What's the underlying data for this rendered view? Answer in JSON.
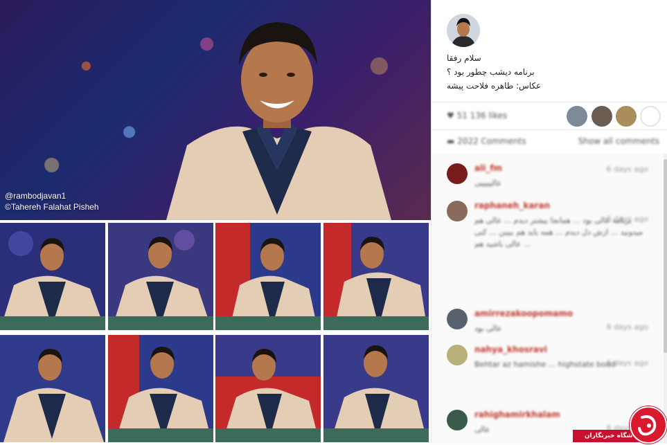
{
  "hero": {
    "handle": "@rambodjavan1",
    "photographer": "©Tahereh Falahat Pisheh"
  },
  "post": {
    "caption_lines": [
      "سلام رفقا",
      "برنامه دیشب چطور بود ؟",
      "عکاس: طاهره فلاحت پیشه"
    ],
    "likes_text": "51 136 likes",
    "comments_count_text": "2022 Comments",
    "show_all_label": "Show all comments"
  },
  "comments": [
    {
      "user": "ali_fm",
      "time": "6 days ago",
      "text": "عالیییییی"
    },
    {
      "user": "raphaneh_karan",
      "time": "6 days ago",
      "text": "برنامه عالی بود ... همانجا بیشتر دیدم ... عالی هم میدونید ... ازش دل دیدم ... همه باید هم ببینن ... کنی ... عالی باشید هم"
    },
    {
      "user": "amirrezakoopomamo",
      "time": "6 days ago",
      "text": "عالی بود"
    },
    {
      "user": "nahya_khosravi",
      "time": "6 days ago",
      "text": "Behtar az hamishe ... highstate bood"
    },
    {
      "user": "rahighamirkhalam",
      "time": "6 days ago",
      "text": "عالی"
    }
  ],
  "watermark": {
    "label": "باشگاه خبرنگاران"
  },
  "colors": {
    "username": "#c0392b",
    "watermark_red": "#c8102e"
  }
}
